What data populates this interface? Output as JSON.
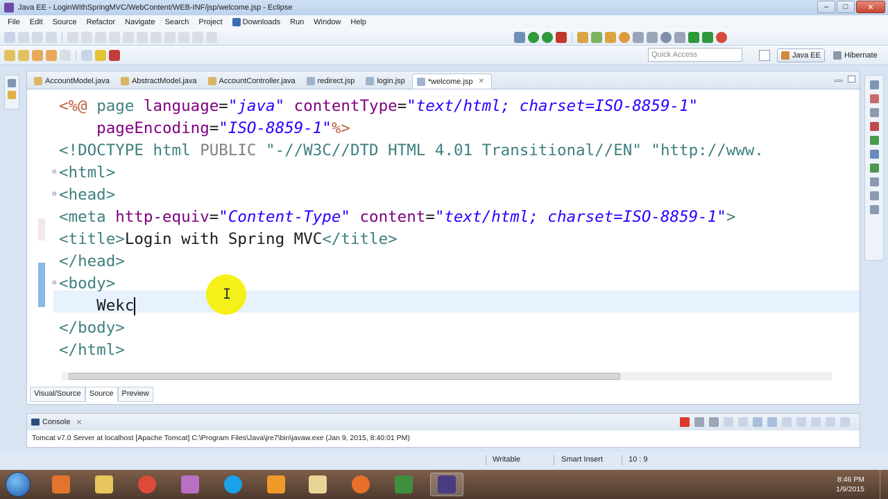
{
  "window": {
    "title": "Java EE - LoginWithSpringMVC/WebContent/WEB-INF/jsp/welcome.jsp - Eclipse"
  },
  "menu": [
    "File",
    "Edit",
    "Source",
    "Refactor",
    "Navigate",
    "Search",
    "Project",
    "Downloads",
    "Run",
    "Window",
    "Help"
  ],
  "toolbar": {
    "quick_access_placeholder": "Quick Access",
    "perspectives": [
      "Java EE",
      "Hibernate"
    ]
  },
  "editor": {
    "tabs": [
      {
        "label": "AccountModel.java",
        "active": false
      },
      {
        "label": "AbstractModel.java",
        "active": false
      },
      {
        "label": "AccountController.java",
        "active": false
      },
      {
        "label": "redirect.jsp",
        "active": false
      },
      {
        "label": "login.jsp",
        "active": false
      },
      {
        "label": "*welcome.jsp",
        "active": true
      }
    ],
    "code": {
      "l1": {
        "a": "<%@ ",
        "b": "page ",
        "c": "language",
        "d": "=",
        "e": "\"java\"",
        "f": " contentType",
        "g": "=",
        "h": "\"text/html; charset=ISO-8859-1\""
      },
      "l2": {
        "a": "    pageEncoding",
        "b": "=",
        "c": "\"ISO-8859-1\"",
        "d": "%>"
      },
      "l3": {
        "a": "<!DOCTYPE ",
        "b": "html ",
        "c": "PUBLIC ",
        "d": "\"-//W3C//DTD HTML 4.01 Transitional//EN\" \"http://www."
      },
      "l4": "<html>",
      "l5": "<head>",
      "l6": {
        "a": "<meta ",
        "b": "http-equiv",
        "c": "=",
        "d": "\"Content-Type\"",
        "e": " content",
        "f": "=",
        "g": "\"text/html; charset=ISO-8859-1\"",
        "h": ">"
      },
      "l7": {
        "a": "<title>",
        "b": "Login with Spring MVC",
        "c": "</title>"
      },
      "l8": "</head>",
      "l9": "<body>",
      "l10": "    Wekc",
      "l11": "</body>",
      "l12": "</html>"
    },
    "bottom_tabs": [
      "Visual/Source",
      "Source",
      "Preview"
    ]
  },
  "console": {
    "title": "Console",
    "text": "Tomcat v7.0 Server at localhost [Apache Tomcat] C:\\Program Files\\Java\\jre7\\bin\\javaw.exe (Jan 9, 2015, 8:40:01 PM)"
  },
  "status": {
    "writable": "Writable",
    "insert_mode": "Smart Insert",
    "position": "10 : 9"
  },
  "taskbar": {
    "time": "8:46 PM",
    "date": "1/9/2015"
  },
  "colors": {
    "tag": "#3f7f7f",
    "attribute": "#7f007f",
    "string": "#2a00ff",
    "directive": "#bf5f3f",
    "current_line": "#e8f2fe"
  }
}
